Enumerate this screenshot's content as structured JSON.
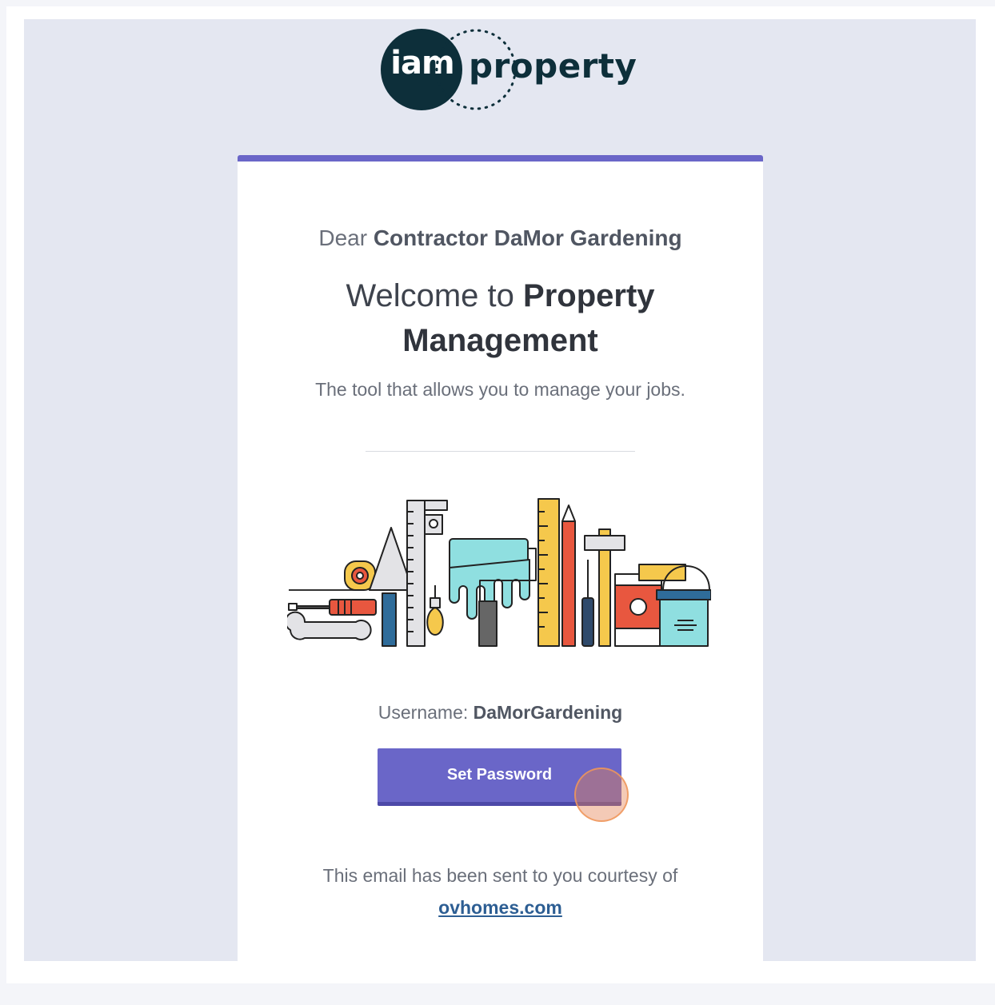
{
  "logo": {
    "icon_text": "iam",
    "wordmark": "property",
    "icon_color": "#0d2f3a"
  },
  "greeting": {
    "prefix": "Dear",
    "name": "Contractor DaMor Gardening"
  },
  "headline": {
    "prefix": "Welcome to",
    "bold_line1": "Property",
    "bold_line2": "Management"
  },
  "subtitle": "The tool that allows you to manage your jobs.",
  "illustration": {
    "icon": "tools-illustration"
  },
  "account": {
    "username_label": "Username:",
    "username": "DaMorGardening"
  },
  "cta": {
    "label": "Set Password",
    "color": "#6a66c8"
  },
  "footer": {
    "text": "This email has been sent to you courtesy of",
    "link_text": "ovhomes.com"
  },
  "colors": {
    "accent": "#6a66c8",
    "page_bg": "#e4e7f1",
    "link": "#2d5e93"
  }
}
